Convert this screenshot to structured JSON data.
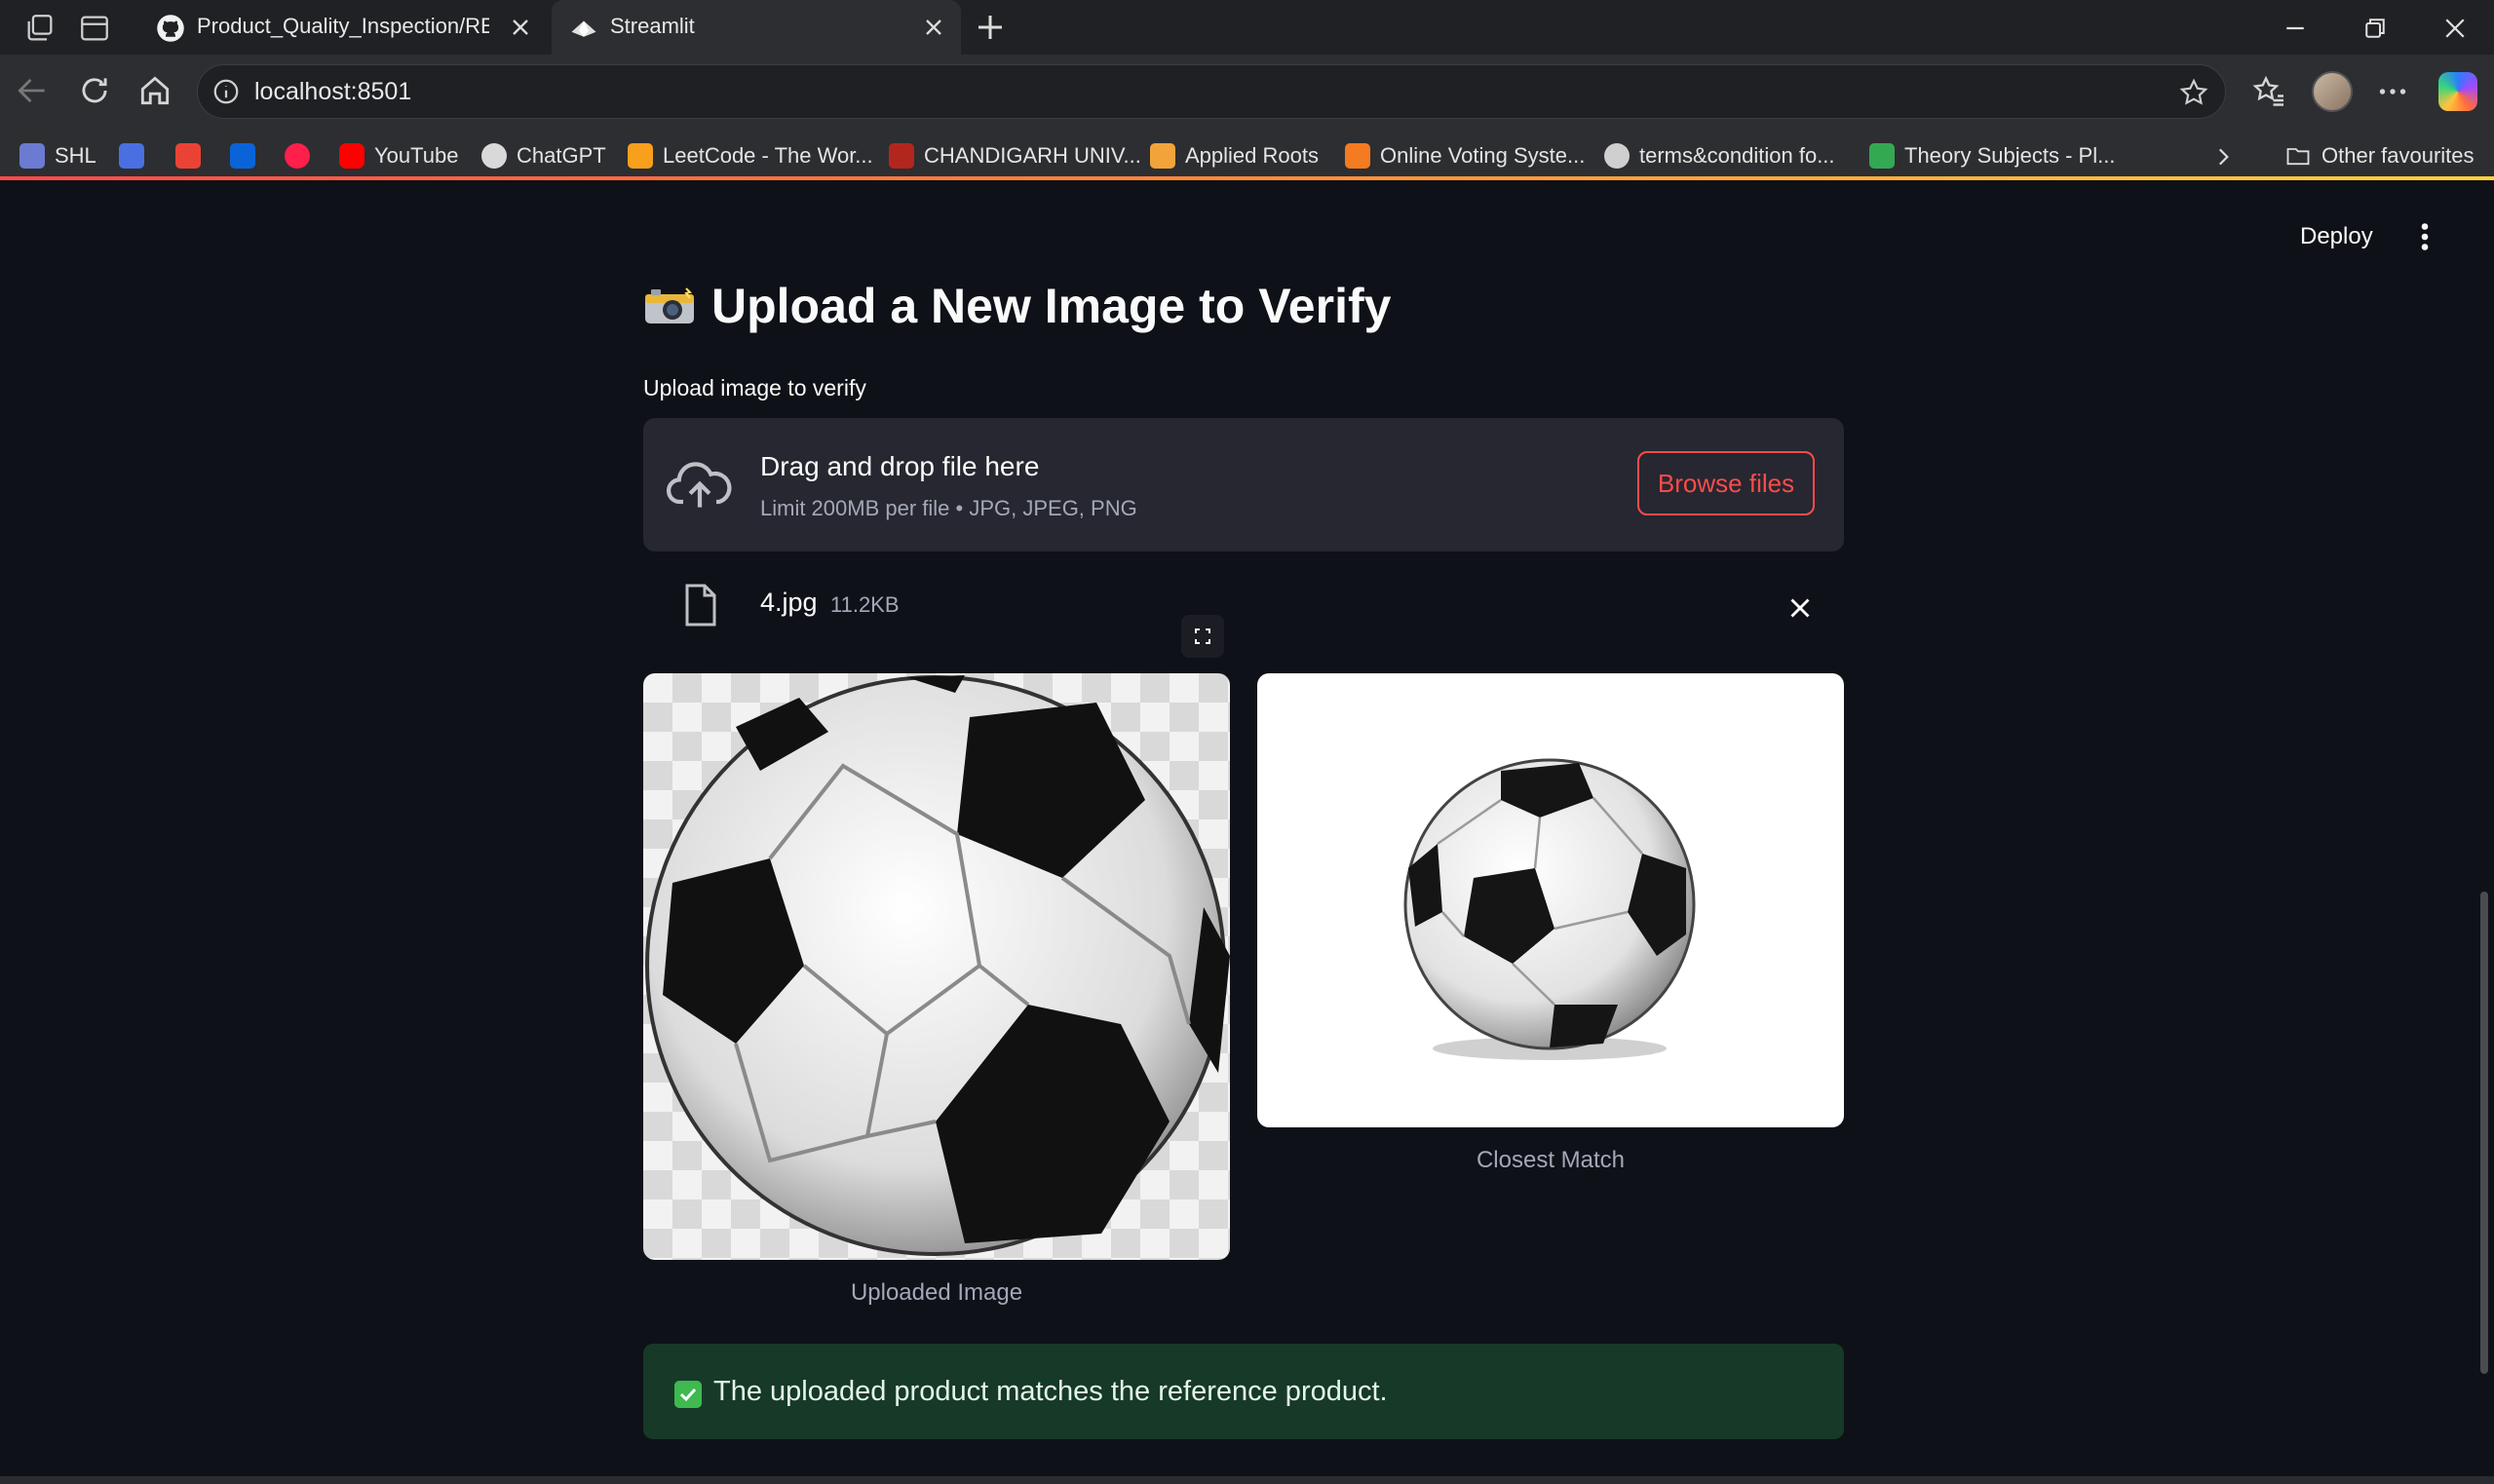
{
  "browser": {
    "tabs": [
      {
        "title": "Product_Quality_Inspection/READ",
        "active": false,
        "favicon": "github-icon"
      },
      {
        "title": "Streamlit",
        "active": true,
        "favicon": "streamlit-icon"
      }
    ],
    "url": "localhost:8501",
    "bookmarks": [
      {
        "label": "SHL",
        "color": "#6b7bd1"
      },
      {
        "label": "",
        "color": "#4a6fe0"
      },
      {
        "label": "",
        "color": "#ea4335"
      },
      {
        "label": "",
        "color": "#0a64d8"
      },
      {
        "label": "",
        "color": "#ff1f4b"
      },
      {
        "label": "YouTube",
        "color": "#ff0000"
      },
      {
        "label": "ChatGPT",
        "color": "#d9d9d9"
      },
      {
        "label": "LeetCode - The Wor...",
        "color": "#f89f1b"
      },
      {
        "label": "CHANDIGARH UNIV...",
        "color": "#b3261e"
      },
      {
        "label": "Applied Roots",
        "color": "#f2a33a"
      },
      {
        "label": "Online Voting Syste...",
        "color": "#f47b20"
      },
      {
        "label": "terms&condition fo...",
        "color": "#cfcfcf"
      },
      {
        "label": "Theory Subjects - Pl...",
        "color": "#34a853"
      }
    ],
    "other_favourites": "Other favourites"
  },
  "app": {
    "deploy_label": "Deploy",
    "heading": "Upload a New Image to Verify",
    "heading_emoji": "camera-with-flash",
    "uploader": {
      "label": "Upload image to verify",
      "drop_title": "Drag and drop file here",
      "drop_limits": "Limit 200MB per file • JPG, JPEG, PNG",
      "browse_label": "Browse files"
    },
    "file": {
      "name": "4.jpg",
      "size": "11.2KB"
    },
    "images": [
      {
        "caption": "Uploaded Image"
      },
      {
        "caption": "Closest Match"
      }
    ],
    "result": {
      "status": "success",
      "message": "The uploaded product matches the reference product."
    },
    "colors": {
      "background": "#0e1117",
      "accent": "#ff4b4b",
      "success_bg": "#173928",
      "success_check": "#3fb950"
    }
  }
}
